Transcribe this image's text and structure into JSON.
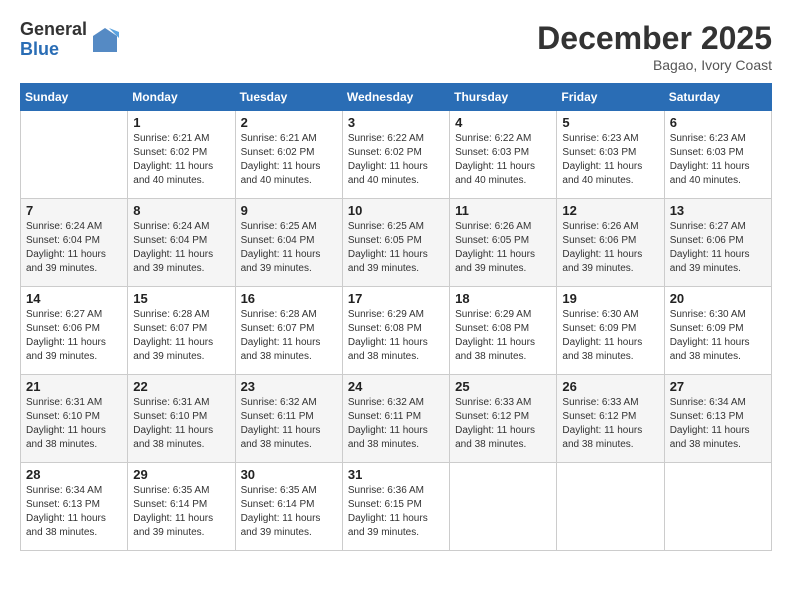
{
  "logo": {
    "general": "General",
    "blue": "Blue"
  },
  "title": "December 2025",
  "subtitle": "Bagao, Ivory Coast",
  "days_header": [
    "Sunday",
    "Monday",
    "Tuesday",
    "Wednesday",
    "Thursday",
    "Friday",
    "Saturday"
  ],
  "weeks": [
    [
      {
        "day": "",
        "sunrise": "",
        "sunset": "",
        "daylight": ""
      },
      {
        "day": "1",
        "sunrise": "Sunrise: 6:21 AM",
        "sunset": "Sunset: 6:02 PM",
        "daylight": "Daylight: 11 hours and 40 minutes."
      },
      {
        "day": "2",
        "sunrise": "Sunrise: 6:21 AM",
        "sunset": "Sunset: 6:02 PM",
        "daylight": "Daylight: 11 hours and 40 minutes."
      },
      {
        "day": "3",
        "sunrise": "Sunrise: 6:22 AM",
        "sunset": "Sunset: 6:02 PM",
        "daylight": "Daylight: 11 hours and 40 minutes."
      },
      {
        "day": "4",
        "sunrise": "Sunrise: 6:22 AM",
        "sunset": "Sunset: 6:03 PM",
        "daylight": "Daylight: 11 hours and 40 minutes."
      },
      {
        "day": "5",
        "sunrise": "Sunrise: 6:23 AM",
        "sunset": "Sunset: 6:03 PM",
        "daylight": "Daylight: 11 hours and 40 minutes."
      },
      {
        "day": "6",
        "sunrise": "Sunrise: 6:23 AM",
        "sunset": "Sunset: 6:03 PM",
        "daylight": "Daylight: 11 hours and 40 minutes."
      }
    ],
    [
      {
        "day": "7",
        "sunrise": "Sunrise: 6:24 AM",
        "sunset": "Sunset: 6:04 PM",
        "daylight": "Daylight: 11 hours and 39 minutes."
      },
      {
        "day": "8",
        "sunrise": "Sunrise: 6:24 AM",
        "sunset": "Sunset: 6:04 PM",
        "daylight": "Daylight: 11 hours and 39 minutes."
      },
      {
        "day": "9",
        "sunrise": "Sunrise: 6:25 AM",
        "sunset": "Sunset: 6:04 PM",
        "daylight": "Daylight: 11 hours and 39 minutes."
      },
      {
        "day": "10",
        "sunrise": "Sunrise: 6:25 AM",
        "sunset": "Sunset: 6:05 PM",
        "daylight": "Daylight: 11 hours and 39 minutes."
      },
      {
        "day": "11",
        "sunrise": "Sunrise: 6:26 AM",
        "sunset": "Sunset: 6:05 PM",
        "daylight": "Daylight: 11 hours and 39 minutes."
      },
      {
        "day": "12",
        "sunrise": "Sunrise: 6:26 AM",
        "sunset": "Sunset: 6:06 PM",
        "daylight": "Daylight: 11 hours and 39 minutes."
      },
      {
        "day": "13",
        "sunrise": "Sunrise: 6:27 AM",
        "sunset": "Sunset: 6:06 PM",
        "daylight": "Daylight: 11 hours and 39 minutes."
      }
    ],
    [
      {
        "day": "14",
        "sunrise": "Sunrise: 6:27 AM",
        "sunset": "Sunset: 6:06 PM",
        "daylight": "Daylight: 11 hours and 39 minutes."
      },
      {
        "day": "15",
        "sunrise": "Sunrise: 6:28 AM",
        "sunset": "Sunset: 6:07 PM",
        "daylight": "Daylight: 11 hours and 39 minutes."
      },
      {
        "day": "16",
        "sunrise": "Sunrise: 6:28 AM",
        "sunset": "Sunset: 6:07 PM",
        "daylight": "Daylight: 11 hours and 38 minutes."
      },
      {
        "day": "17",
        "sunrise": "Sunrise: 6:29 AM",
        "sunset": "Sunset: 6:08 PM",
        "daylight": "Daylight: 11 hours and 38 minutes."
      },
      {
        "day": "18",
        "sunrise": "Sunrise: 6:29 AM",
        "sunset": "Sunset: 6:08 PM",
        "daylight": "Daylight: 11 hours and 38 minutes."
      },
      {
        "day": "19",
        "sunrise": "Sunrise: 6:30 AM",
        "sunset": "Sunset: 6:09 PM",
        "daylight": "Daylight: 11 hours and 38 minutes."
      },
      {
        "day": "20",
        "sunrise": "Sunrise: 6:30 AM",
        "sunset": "Sunset: 6:09 PM",
        "daylight": "Daylight: 11 hours and 38 minutes."
      }
    ],
    [
      {
        "day": "21",
        "sunrise": "Sunrise: 6:31 AM",
        "sunset": "Sunset: 6:10 PM",
        "daylight": "Daylight: 11 hours and 38 minutes."
      },
      {
        "day": "22",
        "sunrise": "Sunrise: 6:31 AM",
        "sunset": "Sunset: 6:10 PM",
        "daylight": "Daylight: 11 hours and 38 minutes."
      },
      {
        "day": "23",
        "sunrise": "Sunrise: 6:32 AM",
        "sunset": "Sunset: 6:11 PM",
        "daylight": "Daylight: 11 hours and 38 minutes."
      },
      {
        "day": "24",
        "sunrise": "Sunrise: 6:32 AM",
        "sunset": "Sunset: 6:11 PM",
        "daylight": "Daylight: 11 hours and 38 minutes."
      },
      {
        "day": "25",
        "sunrise": "Sunrise: 6:33 AM",
        "sunset": "Sunset: 6:12 PM",
        "daylight": "Daylight: 11 hours and 38 minutes."
      },
      {
        "day": "26",
        "sunrise": "Sunrise: 6:33 AM",
        "sunset": "Sunset: 6:12 PM",
        "daylight": "Daylight: 11 hours and 38 minutes."
      },
      {
        "day": "27",
        "sunrise": "Sunrise: 6:34 AM",
        "sunset": "Sunset: 6:13 PM",
        "daylight": "Daylight: 11 hours and 38 minutes."
      }
    ],
    [
      {
        "day": "28",
        "sunrise": "Sunrise: 6:34 AM",
        "sunset": "Sunset: 6:13 PM",
        "daylight": "Daylight: 11 hours and 38 minutes."
      },
      {
        "day": "29",
        "sunrise": "Sunrise: 6:35 AM",
        "sunset": "Sunset: 6:14 PM",
        "daylight": "Daylight: 11 hours and 39 minutes."
      },
      {
        "day": "30",
        "sunrise": "Sunrise: 6:35 AM",
        "sunset": "Sunset: 6:14 PM",
        "daylight": "Daylight: 11 hours and 39 minutes."
      },
      {
        "day": "31",
        "sunrise": "Sunrise: 6:36 AM",
        "sunset": "Sunset: 6:15 PM",
        "daylight": "Daylight: 11 hours and 39 minutes."
      },
      {
        "day": "",
        "sunrise": "",
        "sunset": "",
        "daylight": ""
      },
      {
        "day": "",
        "sunrise": "",
        "sunset": "",
        "daylight": ""
      },
      {
        "day": "",
        "sunrise": "",
        "sunset": "",
        "daylight": ""
      }
    ]
  ]
}
